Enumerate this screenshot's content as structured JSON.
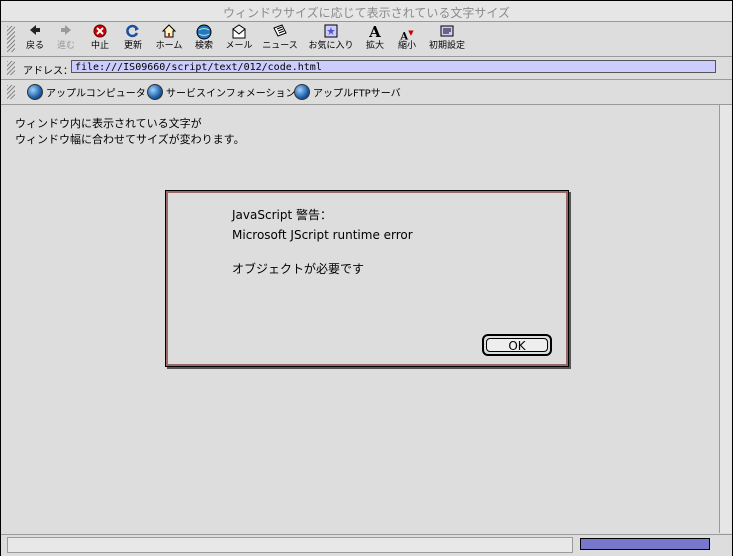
{
  "window": {
    "title": "ウィンドウサイズに応じて表示されている文字サイズ"
  },
  "toolbar": {
    "buttons": [
      {
        "label": "戻る",
        "icon": "back-arrow-icon",
        "glyph": "◆"
      },
      {
        "label": "進む",
        "icon": "forward-arrow-icon",
        "glyph": "◆"
      },
      {
        "label": "中止",
        "icon": "stop-icon",
        "glyph": "✖"
      },
      {
        "label": "更新",
        "icon": "refresh-icon",
        "glyph": "↻"
      },
      {
        "label": "ホーム",
        "icon": "home-icon",
        "glyph": "⌂"
      },
      {
        "label": "検索",
        "icon": "search-globe-icon",
        "glyph": "●"
      },
      {
        "label": "メール",
        "icon": "mail-icon",
        "glyph": "✉"
      },
      {
        "label": "ニュース",
        "icon": "news-icon",
        "glyph": "▤"
      },
      {
        "label": "お気に入り",
        "icon": "favorites-icon",
        "glyph": "✱"
      },
      {
        "label": "拡大",
        "icon": "font-larger-icon",
        "glyph": "A"
      },
      {
        "label": "縮小",
        "icon": "font-smaller-icon",
        "glyph": "A"
      },
      {
        "label": "初期設定",
        "icon": "preferences-icon",
        "glyph": "▦"
      }
    ]
  },
  "address": {
    "label": "アドレス：",
    "value": "file:///IS09660/script/text/012/code.html"
  },
  "favorites": [
    {
      "label": "アップルコンピュータ"
    },
    {
      "label": "サービスインフォメーション"
    },
    {
      "label": "アップルFTPサーバ"
    }
  ],
  "content": {
    "line1": "ウィンドウ内に表示されている文字が",
    "line2": "ウィンドウ幅に合わせてサイズが変わります。"
  },
  "dialog": {
    "title": "JavaScript 警告：",
    "message": "Microsoft JScript runtime error",
    "detail": "オブジェクトが必要です",
    "ok_label": "OK"
  },
  "status": {
    "progress": 1.0
  },
  "colors": {
    "address_bg": "#ccccff",
    "progress_fill": "#7777cc",
    "stop_red": "#cc0000",
    "disabled_text": "#9a9a9a"
  }
}
